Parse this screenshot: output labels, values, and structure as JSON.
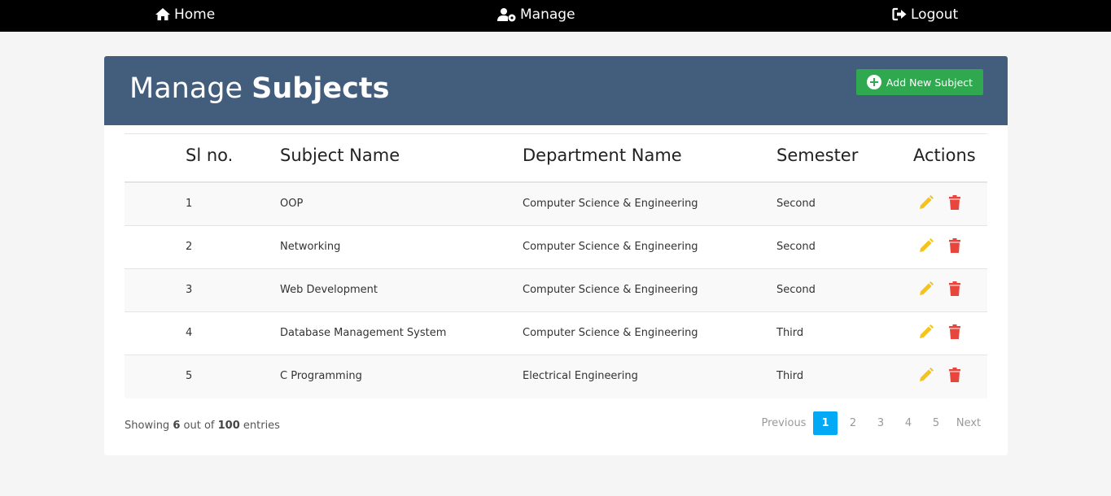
{
  "nav": {
    "home": "Home",
    "manage": "Manage",
    "logout": "Logout"
  },
  "header": {
    "title_prefix": "Manage",
    "title_bold": "Subjects",
    "add_button": "Add New Subject"
  },
  "table": {
    "columns": [
      "Sl no.",
      "Subject Name",
      "Department Name",
      "Semester",
      "Actions"
    ],
    "rows": [
      {
        "sl": "1",
        "subject": "OOP",
        "department": "Computer Science & Engineering",
        "semester": "Second"
      },
      {
        "sl": "2",
        "subject": "Networking",
        "department": "Computer Science & Engineering",
        "semester": "Second"
      },
      {
        "sl": "3",
        "subject": "Web Development",
        "department": "Computer Science & Engineering",
        "semester": "Second"
      },
      {
        "sl": "4",
        "subject": "Database Management System",
        "department": "Computer Science & Engineering",
        "semester": "Third"
      },
      {
        "sl": "5",
        "subject": "C Programming",
        "department": "Electrical Engineering",
        "semester": "Third"
      }
    ]
  },
  "footer": {
    "showing_prefix": "Showing",
    "shown_count": "6",
    "out_of": "out of",
    "total": "100",
    "entries": "entries"
  },
  "pagination": {
    "previous": "Previous",
    "pages": [
      "1",
      "2",
      "3",
      "4",
      "5"
    ],
    "active_page": "1",
    "next": "Next"
  },
  "icons": {
    "edit": "pencil-icon",
    "delete": "trash-icon"
  },
  "colors": {
    "header_bg": "#435d7d",
    "add_button_bg": "#2fa84f",
    "edit_icon": "#f5c31a",
    "delete_icon": "#e8453c",
    "active_page": "#03a9f4"
  }
}
